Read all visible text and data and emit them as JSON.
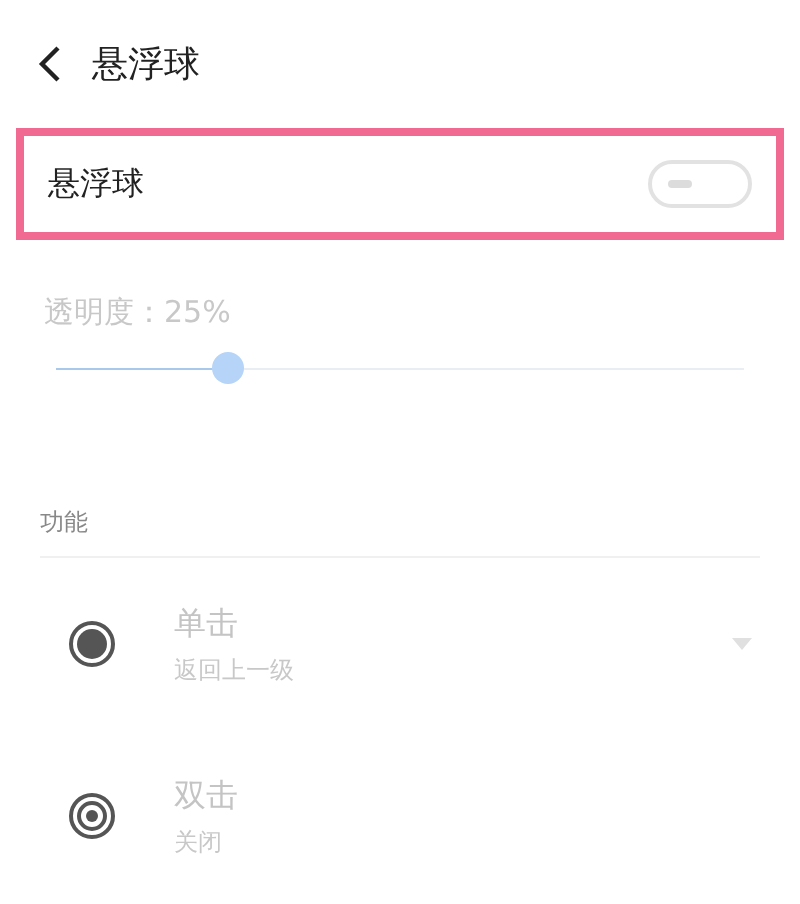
{
  "header": {
    "title": "悬浮球"
  },
  "toggle": {
    "label": "悬浮球",
    "on": false,
    "highlighted": true
  },
  "opacity": {
    "label": "透明度：25%",
    "level": 0.25
  },
  "section": {
    "title": "功能"
  },
  "gestures": [
    {
      "kind": "dot",
      "title": "单击",
      "subtitle": "返回上一级",
      "dropdown": true
    },
    {
      "kind": "rings",
      "title": "双击",
      "subtitle": "关闭",
      "dropdown": false
    }
  ]
}
